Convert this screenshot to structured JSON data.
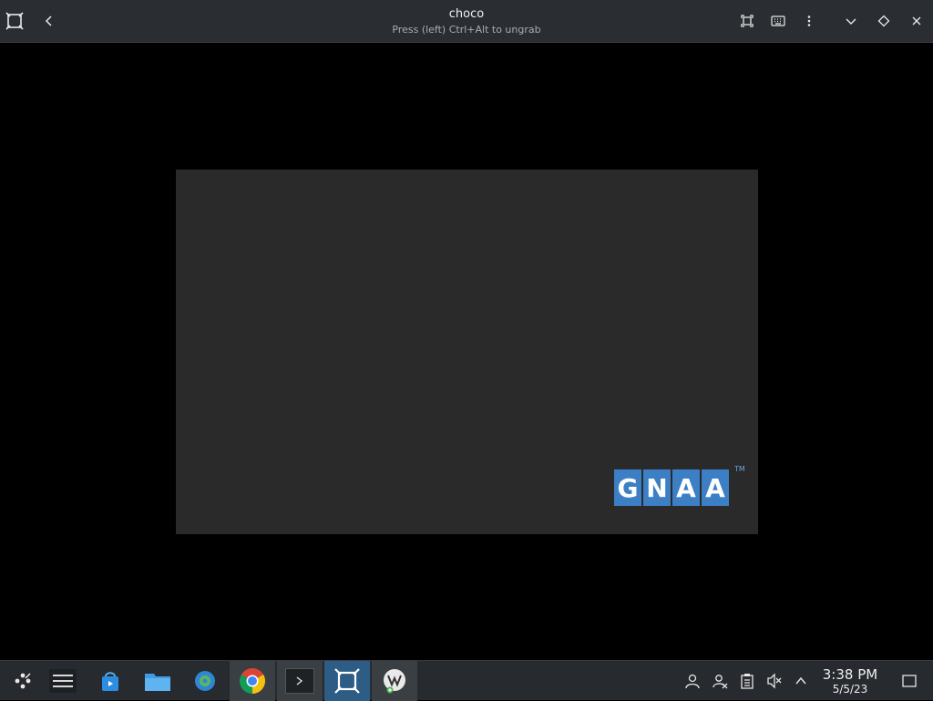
{
  "window": {
    "title": "choco",
    "subtitle": "Press (left) Ctrl+Alt to ungrab",
    "icons": [
      "vm-icon",
      "back-icon",
      "fullscreen-icon",
      "keyboard-icon",
      "menu-icon",
      "minimize-icon",
      "maximize-icon",
      "close-icon"
    ]
  },
  "viewer": {
    "logo_letters": [
      "G",
      "N",
      "A",
      "A"
    ],
    "logo_tm": "TM"
  },
  "taskbar": {
    "apps": [
      "application-launcher",
      "settings-app",
      "discover-store",
      "file-manager",
      "system-settings",
      "chrome-browser",
      "terminal",
      "virtual-machine-manager",
      "virt-viewer"
    ],
    "tray_icons": [
      "user-icon",
      "network-icon",
      "clipboard-icon",
      "volume-muted-icon",
      "tray-expand-icon",
      "show-desktop-icon"
    ],
    "clock": {
      "time": "3:38 PM",
      "date": "5/5/23"
    }
  }
}
